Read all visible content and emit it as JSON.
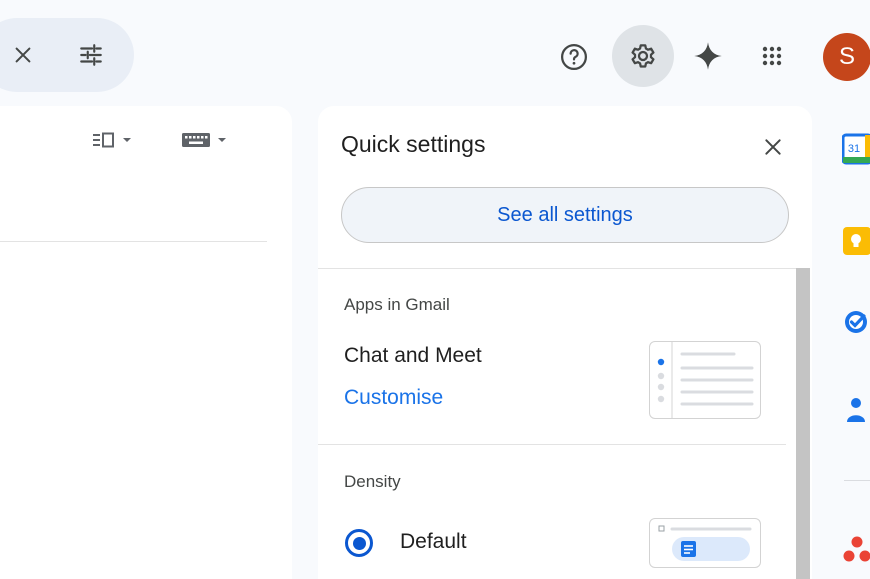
{
  "header": {
    "avatar_initial": "S",
    "icons": [
      "close-icon",
      "tune-icon",
      "help-icon",
      "settings-icon",
      "gemini-icon",
      "apps-grid-icon"
    ]
  },
  "quick_settings": {
    "title": "Quick settings",
    "see_all_label": "See all settings",
    "apps_section": {
      "heading": "Apps in Gmail",
      "item_label": "Chat and Meet",
      "customise_label": "Customise"
    },
    "density_section": {
      "heading": "Density",
      "selected_option": "Default"
    }
  },
  "side_rail": {
    "calendar_day": "31",
    "apps": [
      "calendar-icon",
      "keep-icon",
      "tasks-icon",
      "contacts-icon",
      "get-addons-icon"
    ]
  },
  "colors": {
    "accent": "#0b57d0",
    "link": "#1a73e8",
    "avatar_bg": "#c5461b",
    "panel_bg": "#ffffff",
    "page_bg": "#f8fafd"
  }
}
